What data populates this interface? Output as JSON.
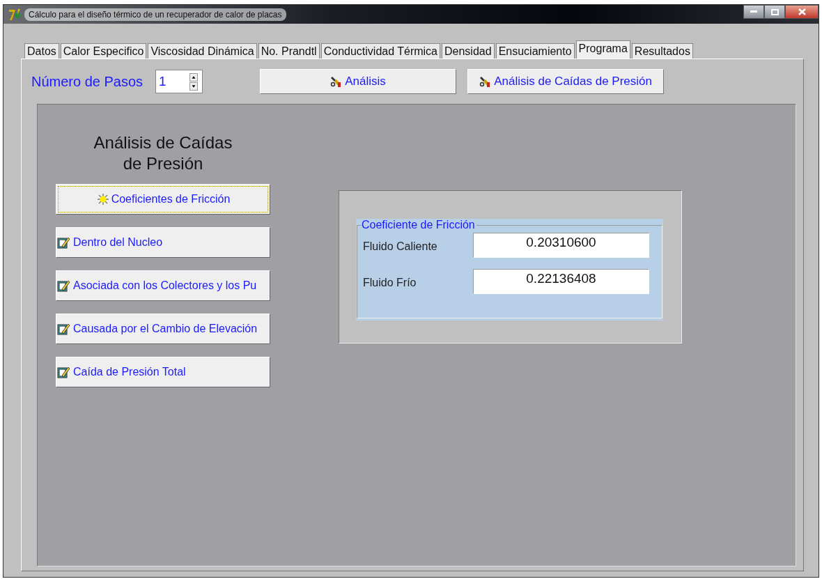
{
  "window": {
    "title": "Cálculo para el diseño térmico de un recuperador de calor de placas"
  },
  "tabs": [
    {
      "label": "Datos",
      "selected": false
    },
    {
      "label": "Calor Especifico",
      "selected": false
    },
    {
      "label": "Viscosidad Dinámica",
      "selected": false
    },
    {
      "label": "No. Prandtl",
      "selected": false
    },
    {
      "label": "Conductividad Térmica",
      "selected": false
    },
    {
      "label": "Densidad",
      "selected": false
    },
    {
      "label": "Ensuciamiento",
      "selected": false
    },
    {
      "label": "Programa",
      "selected": true
    },
    {
      "label": "Resultados",
      "selected": false
    }
  ],
  "steps": {
    "label": "Número de Pasos",
    "value": "1"
  },
  "toolbar_buttons": [
    {
      "label": "Análisis"
    },
    {
      "label": "Análisis de Caídas de Presión"
    }
  ],
  "section_title": "Análisis de Caídas de Presión",
  "side_buttons": [
    {
      "label": "Coeficientes de Fricción",
      "kind": "sun",
      "focused": true
    },
    {
      "label": "Dentro del Nucleo",
      "kind": "note",
      "focused": false
    },
    {
      "label": "Asociada con los Colectores y los Pu",
      "kind": "note",
      "focused": false
    },
    {
      "label": "Causada por el Cambio de Elevación",
      "kind": "note",
      "focused": false
    },
    {
      "label": "Caída de Presión Total",
      "kind": "note",
      "focused": false
    }
  ],
  "group": {
    "title": "Coeficiente de Fricción",
    "fields": [
      {
        "label": "Fluido Caliente",
        "value": "0.20310600"
      },
      {
        "label": "Fluido Frío",
        "value": "0.22136408"
      }
    ]
  }
}
